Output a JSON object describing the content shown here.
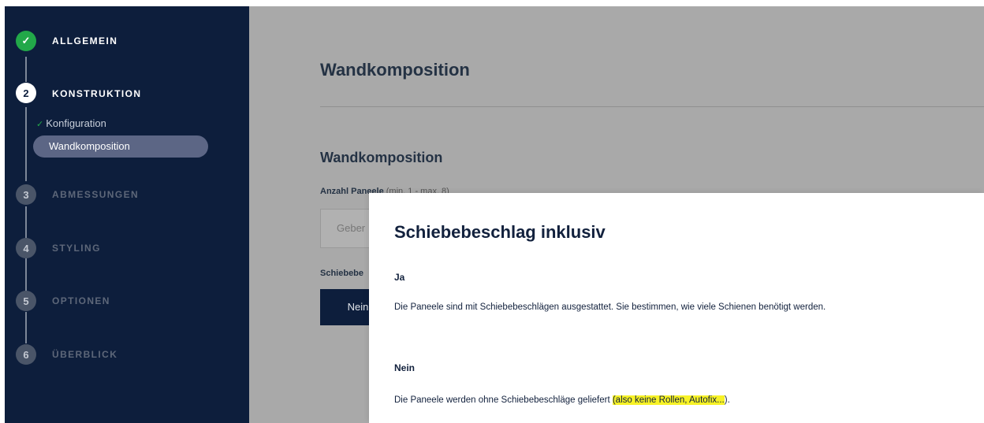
{
  "sidebar": {
    "steps": [
      {
        "number": "✓",
        "label": "ALLGEMEIN",
        "state": "done"
      },
      {
        "number": "2",
        "label": "KONSTRUKTION",
        "state": "active"
      },
      {
        "number": "3",
        "label": "ABMESSUNGEN",
        "state": "todo"
      },
      {
        "number": "4",
        "label": "STYLING",
        "state": "todo"
      },
      {
        "number": "5",
        "label": "OPTIONEN",
        "state": "todo"
      },
      {
        "number": "6",
        "label": "ÜBERBLICK",
        "state": "todo"
      }
    ],
    "sub_items": [
      {
        "label": "Konfiguration",
        "checked": true
      },
      {
        "label": "Wandkomposition",
        "active": true
      }
    ]
  },
  "main": {
    "page_title": "Wandkomposition",
    "section_title": "Wandkomposition",
    "panel_count_label": "Anzahl Paneele",
    "panel_count_hint": "(min. 1 - max. 8)",
    "panel_count_placeholder": "Geber",
    "sliding_label": "Schiebebe",
    "nein_button": "Nein"
  },
  "popup": {
    "title": "Schiebebeschlag inklusiv",
    "options": [
      {
        "title": "Ja",
        "description": "Die Paneele sind mit Schiebebeschlägen ausgestattet. Sie bestimmen, wie viele Schienen benötigt werden."
      },
      {
        "title": "Nein",
        "description_plain": "Die Paneele werden ohne Schiebebeschläge geliefert ",
        "description_highlight": "(also keine Rollen, Autofix...",
        "description_end": ")."
      }
    ]
  },
  "colors": {
    "sidebar_bg": "#0d1e3c",
    "done_green": "#22a849",
    "highlight_yellow": "#f7f226",
    "overlay_gray": "#a9a9a9"
  }
}
